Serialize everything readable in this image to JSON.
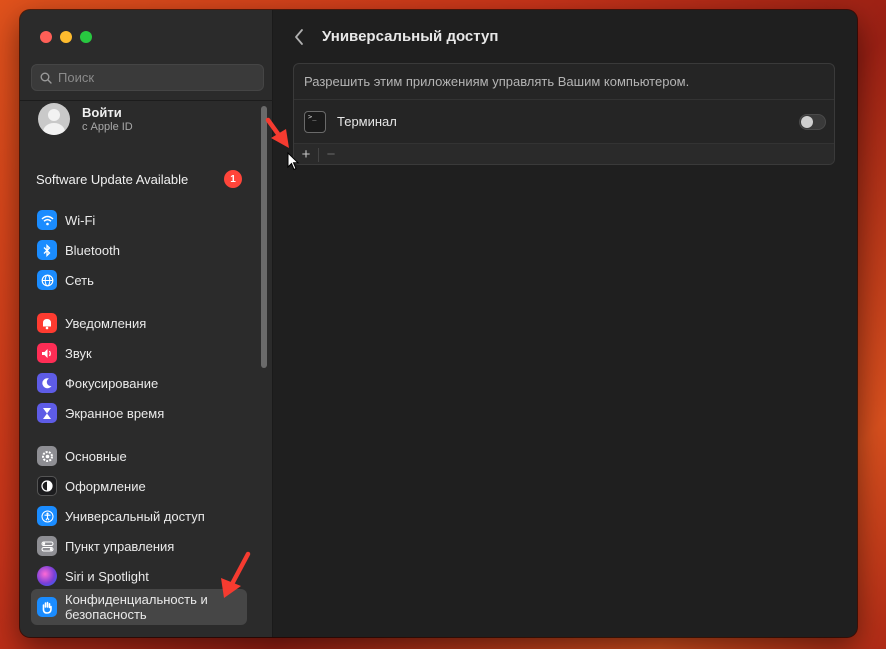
{
  "sidebar": {
    "search_placeholder": "Поиск",
    "account": {
      "title": "Войти",
      "subtitle": "с Apple ID"
    },
    "update": {
      "label": "Software Update Available",
      "badge": "1"
    },
    "items": [
      {
        "label": "Wi-Fi",
        "color": "#1a8cff",
        "icon": "wifi-icon"
      },
      {
        "label": "Bluetooth",
        "color": "#1a8cff",
        "icon": "bluetooth-icon"
      },
      {
        "label": "Сеть",
        "color": "#1a8cff",
        "icon": "globe-icon"
      },
      {
        "label": "Уведомления",
        "color": "#ff3b30",
        "icon": "bell-icon"
      },
      {
        "label": "Звук",
        "color": "#ff2d55",
        "icon": "speaker-icon"
      },
      {
        "label": "Фокусирование",
        "color": "#5e5ce6",
        "icon": "moon-icon"
      },
      {
        "label": "Экранное время",
        "color": "#5e5ce6",
        "icon": "hourglass-icon"
      },
      {
        "label": "Основные",
        "color": "#8e8e93",
        "icon": "gear-icon"
      },
      {
        "label": "Оформление",
        "color": "#1c1c1e",
        "icon": "appearance-icon"
      },
      {
        "label": "Универсальный доступ",
        "color": "#1a8cff",
        "icon": "accessibility-icon"
      },
      {
        "label": "Пункт управления",
        "color": "#8e8e93",
        "icon": "control-center-icon"
      },
      {
        "label": "Siri и Spotlight",
        "color": "#7a3fd6",
        "icon": "siri-icon"
      },
      {
        "label": "Конфиденциальность и безопасность",
        "color": "#1a8cff",
        "icon": "hand-icon",
        "selected": true
      }
    ]
  },
  "main": {
    "title": "Универсальный доступ",
    "description": "Разрешить этим приложениям управлять Вашим компьютером.",
    "apps": [
      {
        "label": "Терминал",
        "enabled": false
      }
    ],
    "add_label": "+",
    "remove_label": "−"
  },
  "colors": {
    "annotation_arrow": "#f53b30"
  }
}
